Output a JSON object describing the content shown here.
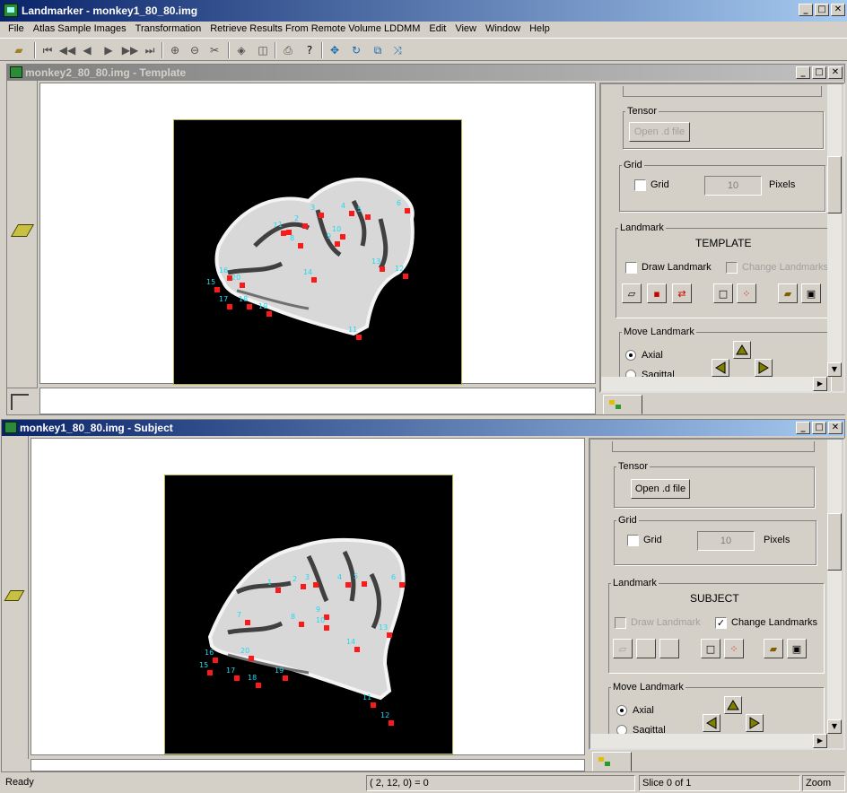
{
  "app": {
    "title": "Landmarker - monkey1_80_80.img",
    "min": "_",
    "max": "□",
    "close": "✕"
  },
  "menu": [
    "File",
    "Atlas Sample Images",
    "Transformation",
    "Retrieve Results From Remote Volume LDDMM",
    "Edit",
    "View",
    "Window",
    "Help"
  ],
  "template_window": {
    "title": "monkey2_80_80.img - Template",
    "panel": {
      "tensor_legend": "Tensor",
      "open_d_file": "Open .d file",
      "grid_legend": "Grid",
      "grid_label": "Grid",
      "grid_value": "10",
      "pixels": "Pixels",
      "landmark_legend": "Landmark",
      "mode": "TEMPLATE",
      "draw_landmark": "Draw Landmark",
      "change_landmarks": "Change Landmarks",
      "move_landmark_legend": "Move Landmark",
      "axial": "Axial",
      "sagittal": "Sagittal"
    },
    "landmark_labels": [
      "1",
      "2",
      "3",
      "4",
      "5",
      "6",
      "7",
      "8",
      "9",
      "10",
      "11",
      "12",
      "13",
      "14",
      "15",
      "16",
      "17",
      "18",
      "19",
      "20"
    ]
  },
  "subject_window": {
    "title": "monkey1_80_80.img - Subject",
    "panel": {
      "tensor_legend": "Tensor",
      "open_d_file": "Open .d file",
      "grid_legend": "Grid",
      "grid_label": "Grid",
      "grid_value": "10",
      "pixels": "Pixels",
      "landmark_legend": "Landmark",
      "mode": "SUBJECT",
      "draw_landmark": "Draw Landmark",
      "change_landmarks": "Change Landmarks",
      "move_landmark_legend": "Move Landmark",
      "axial": "Axial",
      "sagittal": "Sagittal"
    }
  },
  "status": {
    "ready": "Ready",
    "coords": "(   2,  12,   0) = 0",
    "slice": "Slice 0 of 1",
    "zoom": "Zoom"
  },
  "toolbar_icons": [
    "open-folder-icon",
    "first-icon",
    "prev-fast-icon",
    "prev-icon",
    "next-icon",
    "next-fast-icon",
    "last-icon",
    "zoom-in-icon",
    "zoom-out-icon",
    "tools-icon",
    "layers-icon",
    "layers2-icon",
    "print-icon",
    "help-icon",
    "move-icon",
    "rotate-icon",
    "scale-icon",
    "transform-icon"
  ],
  "colors": {
    "title_active": "#0a246a",
    "landmark": "#ff1818",
    "landmark_label": "#20d8f0"
  }
}
